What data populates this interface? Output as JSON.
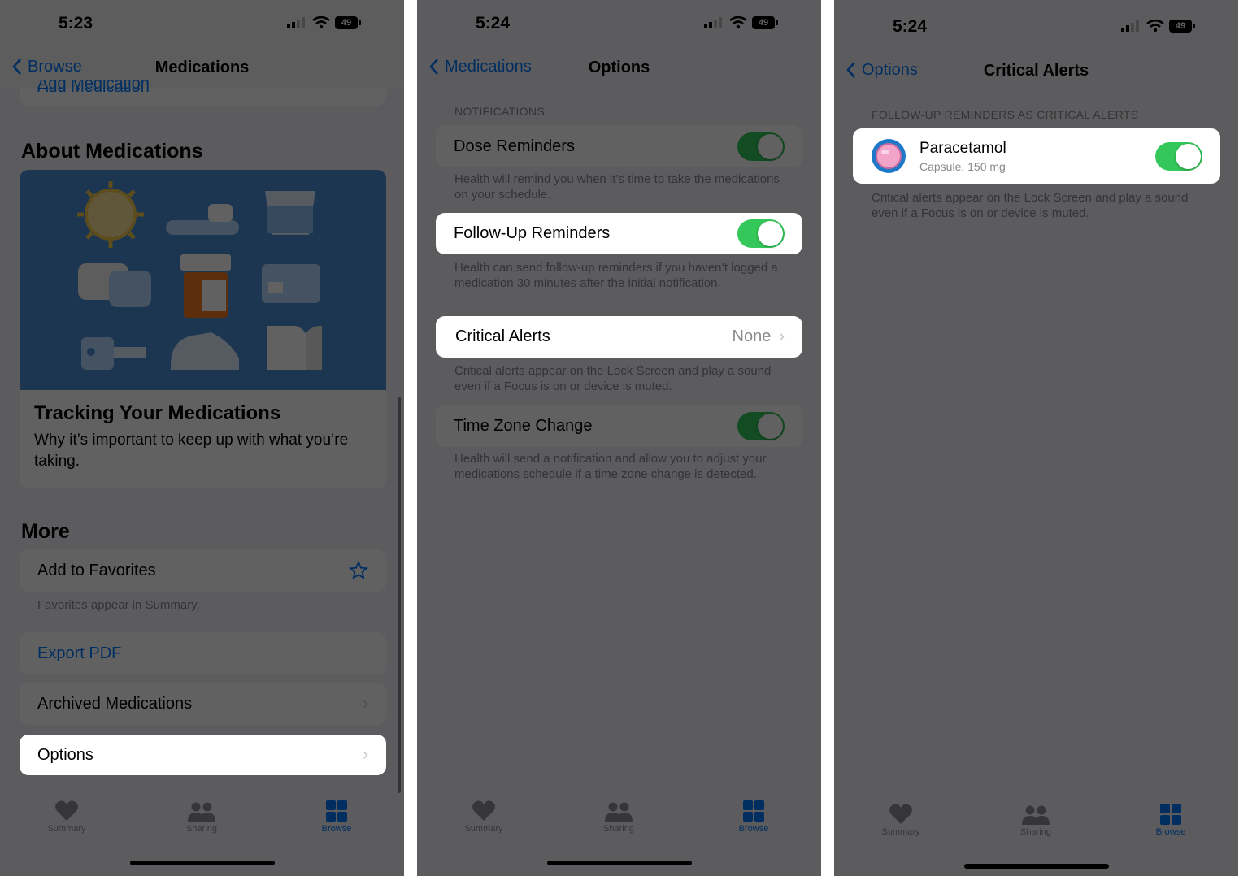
{
  "colors": {
    "accent": "#007aff",
    "toggle_on": "#34c759",
    "dim_overlay": "rgba(0,0,0,0.62)"
  },
  "screen1": {
    "time": "5:23",
    "battery": "49",
    "back_label": "Browse",
    "title": "Medications",
    "partial_link": "Add Medication",
    "about_header": "About Medications",
    "article_title": "Tracking Your Medications",
    "article_subtitle": "Why it’s important to keep up with what you’re taking.",
    "more_header": "More",
    "favorites_label": "Add to Favorites",
    "favorites_footer": "Favorites appear in Summary.",
    "export_label": "Export PDF",
    "archived_label": "Archived Medications",
    "options_label": "Options",
    "tabs": [
      {
        "label": "Summary",
        "icon": "heart-icon"
      },
      {
        "label": "Sharing",
        "icon": "people-icon"
      },
      {
        "label": "Browse",
        "icon": "grid-icon"
      }
    ]
  },
  "screen2": {
    "time": "5:24",
    "battery": "49",
    "back_label": "Medications",
    "title": "Options",
    "section_header": "NOTIFICATIONS",
    "dose_label": "Dose Reminders",
    "dose_on": true,
    "dose_footer": "Health will remind you when it’s time to take the medications on your schedule.",
    "followup_label": "Follow-Up Reminders",
    "followup_on": true,
    "followup_footer": "Health can send follow-up reminders if you haven’t logged a medication 30 minutes after the initial notification.",
    "critical_label": "Critical Alerts",
    "critical_value": "None",
    "critical_footer": "Critical alerts appear on the Lock Screen and play a sound even if a Focus is on or device is muted.",
    "timezone_label": "Time Zone Change",
    "timezone_on": true,
    "timezone_footer": "Health will send a notification and allow you to adjust your medications schedule if a time zone change is detected.",
    "tabs": [
      {
        "label": "Summary",
        "icon": "heart-icon"
      },
      {
        "label": "Sharing",
        "icon": "people-icon"
      },
      {
        "label": "Browse",
        "icon": "grid-icon"
      }
    ]
  },
  "screen3": {
    "time": "5:24",
    "battery": "49",
    "back_label": "Options",
    "title": "Critical Alerts",
    "section_header": "FOLLOW-UP REMINDERS AS CRITICAL ALERTS",
    "med_name": "Paracetamol",
    "med_detail": "Capsule, 150 mg",
    "med_on": true,
    "footer": "Critical alerts appear on the Lock Screen and play a sound even if a Focus is on or device is muted.",
    "tabs": [
      {
        "label": "Summary",
        "icon": "heart-icon"
      },
      {
        "label": "Sharing",
        "icon": "people-icon"
      },
      {
        "label": "Browse",
        "icon": "grid-icon"
      }
    ]
  }
}
